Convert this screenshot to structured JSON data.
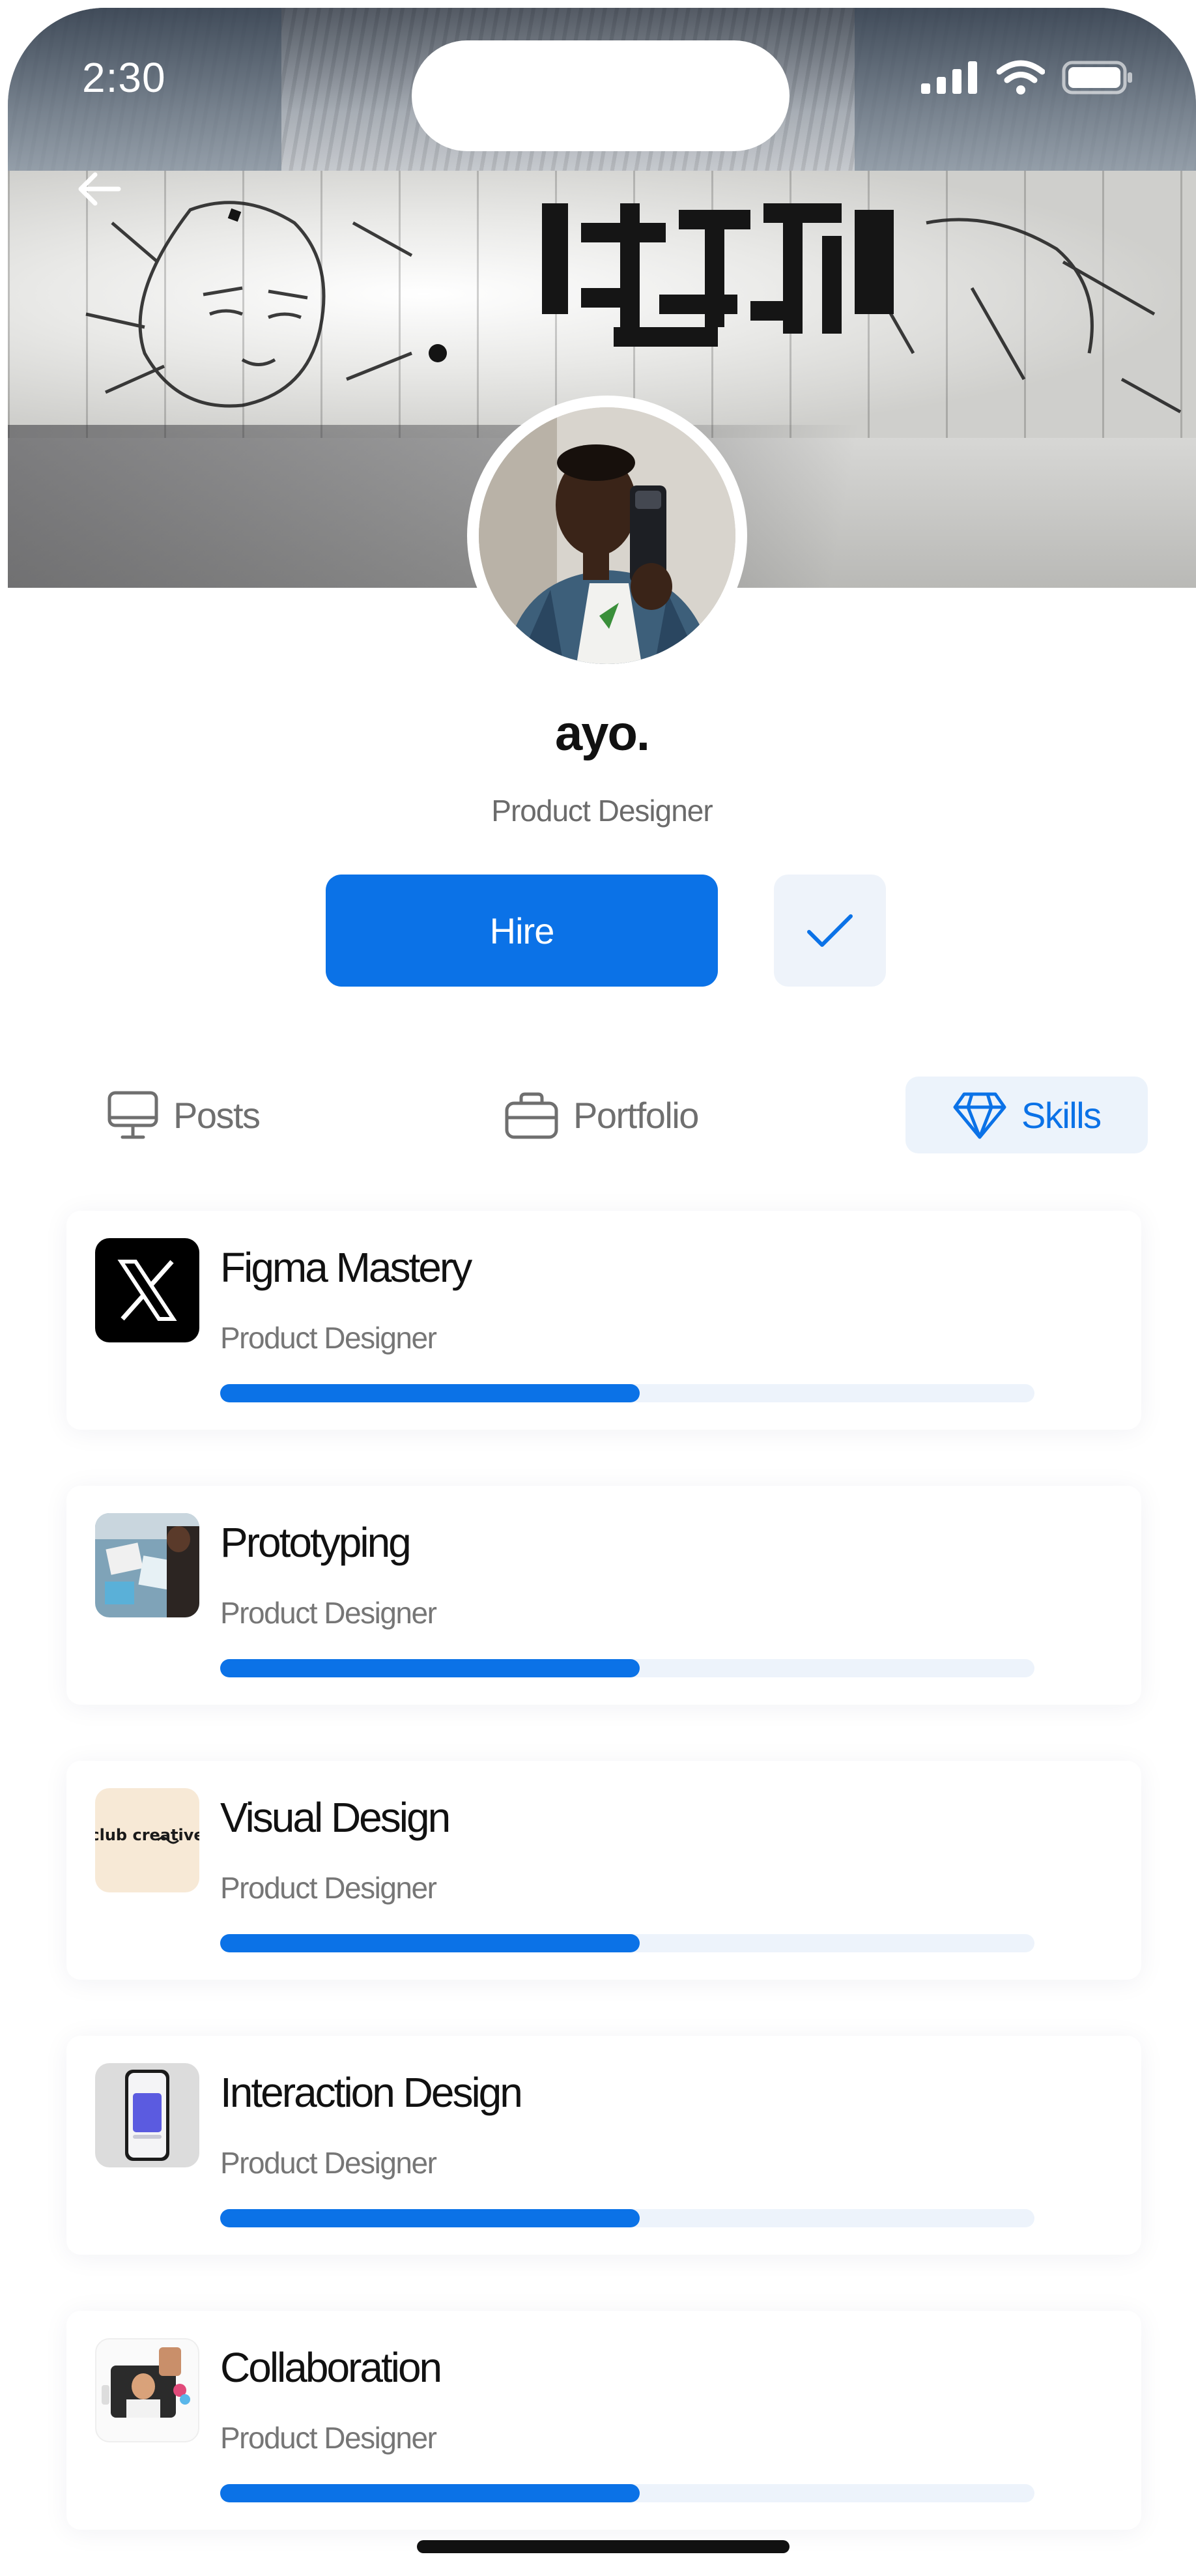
{
  "status_bar": {
    "time": "2:30"
  },
  "profile": {
    "name": "ayo.",
    "role": "Product Designer"
  },
  "actions": {
    "hire_label": "Hire"
  },
  "tabs": [
    {
      "label": "Posts",
      "icon": "monitor-icon",
      "active": false
    },
    {
      "label": "Portfolio",
      "icon": "briefcase-icon",
      "active": false
    },
    {
      "label": "Skills",
      "icon": "diamond-icon",
      "active": true
    }
  ],
  "skills": [
    {
      "title": "Figma Mastery",
      "subtitle": "Product Designer",
      "progress": 0.515,
      "thumb": "x-logo-icon"
    },
    {
      "title": "Prototyping",
      "subtitle": "Product Designer",
      "progress": 0.515,
      "thumb": "prototyping-photo"
    },
    {
      "title": "Visual Design",
      "subtitle": "Product Designer",
      "progress": 0.515,
      "thumb": "club-creative-logo",
      "thumb_text": "club creative"
    },
    {
      "title": "Interaction Design",
      "subtitle": "Product Designer",
      "progress": 0.515,
      "thumb": "phone-mockup-photo"
    },
    {
      "title": "Collaboration",
      "subtitle": "Product Designer",
      "progress": 0.515,
      "thumb": "video-call-photo"
    }
  ],
  "colors": {
    "accent": "#0b72e7",
    "accent_soft": "#ecf3fb",
    "text": "#111111",
    "muted": "#767676"
  }
}
